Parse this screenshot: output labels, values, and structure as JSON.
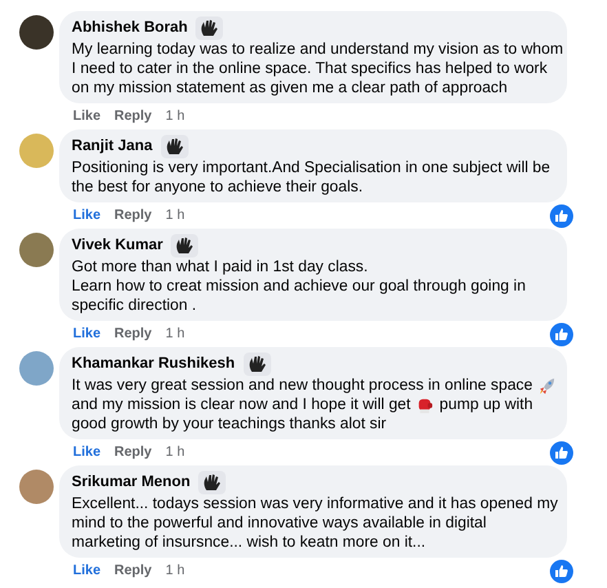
{
  "comments": [
    {
      "author": "Abhishek Borah",
      "lines": [
        [
          {
            "kind": "text",
            "text": "My learning today was to realize and understand my vision as to whom"
          }
        ],
        [
          {
            "kind": "text",
            "text": "I need to cater in the online space. That specifics has helped to work"
          }
        ],
        [
          {
            "kind": "text",
            "text": "on my mission statement as given me a clear path of approach"
          }
        ]
      ],
      "like": "Like",
      "reply": "Reply",
      "time": "1 h",
      "liked": false,
      "reacted": false
    },
    {
      "author": "Ranjit Jana",
      "lines": [
        [
          {
            "kind": "text",
            "text": "Positioning is very important.And Specialisation in one subject will be"
          }
        ],
        [
          {
            "kind": "text",
            "text": "the best for anyone to achieve their goals."
          }
        ]
      ],
      "like": "Like",
      "reply": "Reply",
      "time": "1 h",
      "liked": true,
      "reacted": true
    },
    {
      "author": "Vivek Kumar",
      "lines": [
        [
          {
            "kind": "text",
            "text": "Got more than what I paid in 1st day class."
          }
        ],
        [
          {
            "kind": "text",
            "text": "Learn how to creat mission and achieve our goal through going in"
          }
        ],
        [
          {
            "kind": "text",
            "text": "specific direction ."
          }
        ]
      ],
      "like": "Like",
      "reply": "Reply",
      "time": "1 h",
      "liked": true,
      "reacted": true
    },
    {
      "author": "Khamankar Rushikesh",
      "lines": [
        [
          {
            "kind": "text",
            "text": "It was very great session and new thought process in online space"
          },
          {
            "kind": "rocket"
          }
        ],
        [
          {
            "kind": "text",
            "text": "and my mission is clear now and I hope it will get"
          },
          {
            "kind": "glove"
          },
          {
            "kind": "text",
            "text": "pump up with"
          }
        ],
        [
          {
            "kind": "text",
            "text": "good growth by your teachings thanks alot sir"
          }
        ]
      ],
      "like": "Like",
      "reply": "Reply",
      "time": "1 h",
      "liked": true,
      "reacted": true
    },
    {
      "author": "Srikumar Menon",
      "lines": [
        [
          {
            "kind": "text",
            "text": "Excellent... todays session was very informative and it has opened my"
          }
        ],
        [
          {
            "kind": "text",
            "text": "mind to the powerful and innovative ways available in digital"
          }
        ],
        [
          {
            "kind": "text",
            "text": "marketing of insursnce... wish to keatn more on it..."
          }
        ]
      ],
      "like": "Like",
      "reply": "Reply",
      "time": "1 h",
      "liked": true,
      "reacted": true
    }
  ]
}
